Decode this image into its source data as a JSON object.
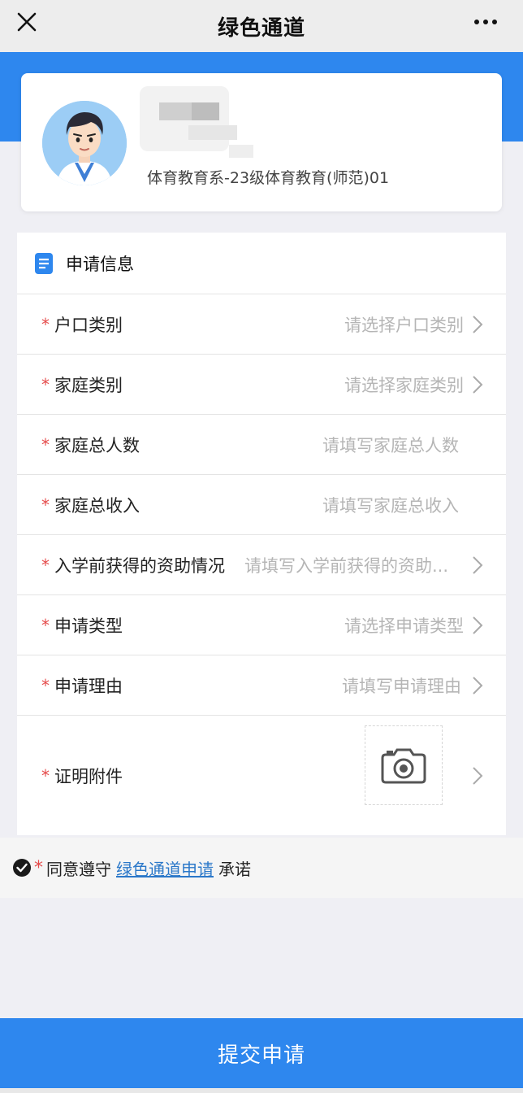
{
  "topbar": {
    "title": "绿色通道"
  },
  "profile": {
    "department": "体育教育系-23级体育教育(师范)01"
  },
  "section": {
    "title": "申请信息"
  },
  "fields": [
    {
      "label": "户口类别",
      "value": "请选择户口类别"
    },
    {
      "label": "家庭类别",
      "value": "请选择家庭类别"
    },
    {
      "label": "家庭总人数",
      "value": "请填写家庭总人数"
    },
    {
      "label": "家庭总收入",
      "value": "请填写家庭总收入"
    },
    {
      "label": "入学前获得的资助情况",
      "value": "请填写入学前获得的资助..."
    },
    {
      "label": "申请类型",
      "value": "请选择申请类型"
    },
    {
      "label": "申请理由",
      "value": "请填写申请理由"
    },
    {
      "label": "证明附件",
      "value": ""
    }
  ],
  "required_mark": "*",
  "agreement": {
    "prefix": "同意遵守",
    "link": "绿色通道申请",
    "suffix": "承诺"
  },
  "submit": {
    "label": "提交申请"
  },
  "colors": {
    "accent": "#2e87ee",
    "required": "#e54b4b",
    "link": "#2b78c9"
  }
}
